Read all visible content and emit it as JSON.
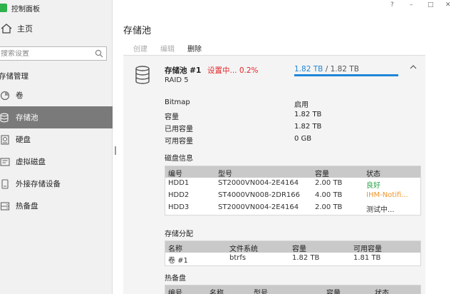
{
  "app": {
    "title": "控制面板",
    "window_controls": [
      "?",
      "–",
      "□",
      "✕"
    ]
  },
  "sidebar": {
    "home_label": "主页",
    "search_placeholder": "搜索设置",
    "section_title": "存储管理",
    "items": [
      {
        "label": "卷",
        "icon": "volume-icon"
      },
      {
        "label": "存储池",
        "icon": "storage-pool-icon",
        "active": true
      },
      {
        "label": "硬盘",
        "icon": "hard-disk-icon"
      },
      {
        "label": "虚拟磁盘",
        "icon": "virtual-disk-icon"
      },
      {
        "label": "外接存储设备",
        "icon": "external-storage-icon"
      },
      {
        "label": "热备盘",
        "icon": "hot-spare-icon"
      }
    ]
  },
  "main": {
    "title": "存储池",
    "toolbar": {
      "create": "创建",
      "edit": "编辑",
      "delete": "删除"
    },
    "pool": {
      "name": "存储池 #1",
      "status": "设置中... 0.2%",
      "raid": "RAID 5",
      "capacity_used": "1.82 TB",
      "capacity_sep": "/",
      "capacity_total": "1.82 TB",
      "capacity_fill": 1.0,
      "colors": {
        "accent": "#1e86d8",
        "status": "#e5262a",
        "warn": "#f0952a",
        "good": "#2ba24a"
      },
      "props": [
        {
          "key": "Bitmap",
          "value": "启用"
        },
        {
          "key": "容量",
          "value": "1.82 TB"
        },
        {
          "key": "已用容量",
          "value": "1.82 TB"
        },
        {
          "key": "可用容量",
          "value": "0 GB"
        }
      ]
    },
    "disk_info": {
      "title": "磁盘信息",
      "headers": [
        "编号",
        "型号",
        "容量",
        "状态"
      ],
      "rows": [
        [
          "HDD1",
          "ST2000VN004-2E4164",
          "2.00 TB",
          "良好"
        ],
        [
          "HDD2",
          "ST4000VN008-2DR166",
          "4.00 TB",
          "IHM-Notifi..."
        ],
        [
          "HDD3",
          "ST2000VN004-2E4164",
          "2.00 TB",
          "测试中..."
        ]
      ]
    },
    "allocation": {
      "title": "存储分配",
      "headers": [
        "名称",
        "文件系统",
        "容量",
        "可用容量"
      ],
      "rows": [
        [
          "卷 #1",
          "btrfs",
          "1.82 TB",
          "1.81 TB"
        ]
      ]
    },
    "hot_spare": {
      "title": "热备盘",
      "headers": [
        "编号",
        "名称",
        "型号",
        "容量",
        "状态"
      ]
    }
  }
}
